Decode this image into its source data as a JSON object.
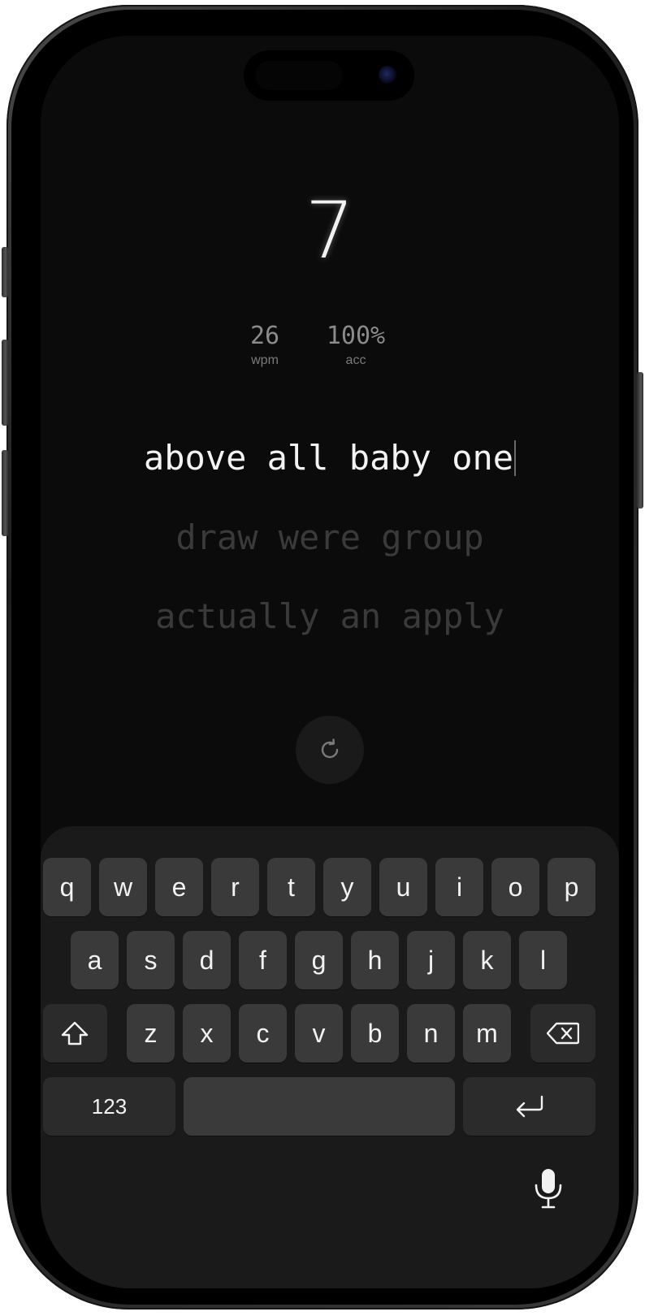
{
  "counter": "7",
  "stats": {
    "wpm": {
      "value": "26",
      "label": "wpm"
    },
    "acc": {
      "value": "100%",
      "label": "acc"
    }
  },
  "lines": {
    "active": "above all baby one",
    "next1": "draw were group",
    "next2": "actually an apply"
  },
  "icons": {
    "restart": "restart-icon",
    "shift": "shift-icon",
    "backspace": "backspace-icon",
    "return": "return-icon",
    "mic": "microphone-icon"
  },
  "keyboard": {
    "row1": [
      "q",
      "w",
      "e",
      "r",
      "t",
      "y",
      "u",
      "i",
      "o",
      "p"
    ],
    "row2": [
      "a",
      "s",
      "d",
      "f",
      "g",
      "h",
      "j",
      "k",
      "l"
    ],
    "row3": [
      "z",
      "x",
      "c",
      "v",
      "b",
      "n",
      "m"
    ],
    "numbers_label": "123"
  },
  "colors": {
    "screen_bg": "#0b0b0b",
    "keyboard_bg": "#1a1a1a",
    "key_bg": "#3a3a3a",
    "text_active": "#f3f3f3",
    "text_upcoming": "#3a3a3a"
  }
}
